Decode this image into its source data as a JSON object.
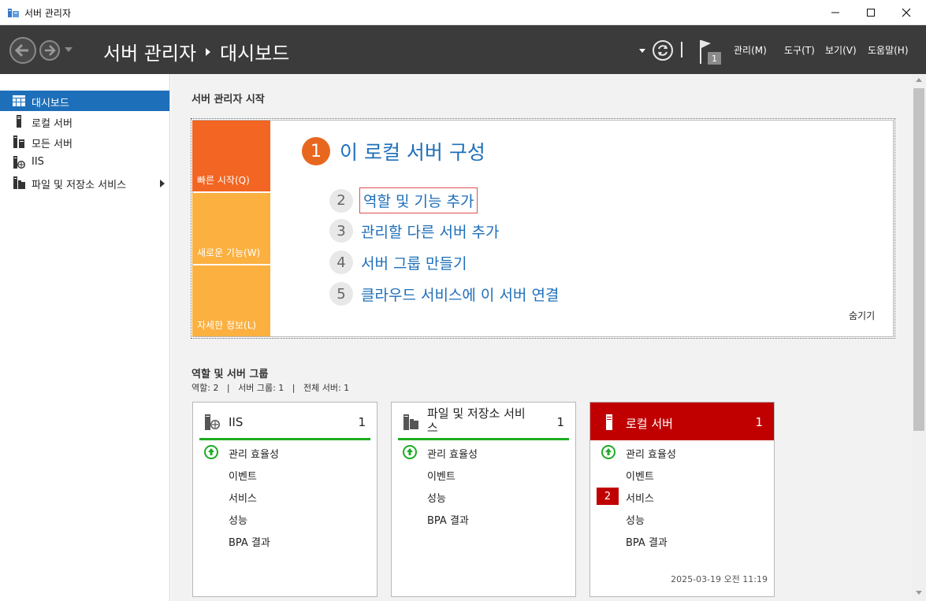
{
  "window": {
    "title": "서버 관리자"
  },
  "header": {
    "breadcrumb_root": "서버 관리자",
    "breadcrumb_page": "대시보드",
    "flag_count": "1",
    "menus": [
      "관리(M)",
      "도구(T)",
      "보기(V)",
      "도움말(H)"
    ]
  },
  "sidebar": {
    "items": [
      {
        "label": "대시보드",
        "icon": "dashboard-icon",
        "selected": true
      },
      {
        "label": "로컬 서버",
        "icon": "server-icon"
      },
      {
        "label": "모든 서버",
        "icon": "servers-icon"
      },
      {
        "label": "IIS",
        "icon": "iis-icon"
      },
      {
        "label": "파일 및 저장소 서비스",
        "icon": "file-storage-icon",
        "has_children": true
      }
    ]
  },
  "welcome": {
    "title": "서버 관리자 시작",
    "tabs": [
      "빠른 시작(Q)",
      "새로운 기능(W)",
      "자세한 정보(L)"
    ],
    "main_step": {
      "number": "1",
      "label": "이 로컬 서버 구성"
    },
    "steps": [
      {
        "number": "2",
        "label": "역할 및 기능 추가"
      },
      {
        "number": "3",
        "label": "관리할 다른 서버 추가"
      },
      {
        "number": "4",
        "label": "서버 그룹 만들기"
      },
      {
        "number": "5",
        "label": "클라우드 서비스에 이 서버 연결"
      }
    ],
    "hide_label": "숨기기"
  },
  "roles": {
    "title": "역할 및 서버 그룹",
    "summary": "역할: 2   |   서버 그룹: 1   |   전체 서버: 1",
    "tiles": [
      {
        "name": "IIS",
        "count": "1",
        "rows": [
          "관리 효율성",
          "이벤트",
          "서비스",
          "성능",
          "BPA 결과"
        ]
      },
      {
        "name_line1": "파일 및 저장소 서비",
        "name_line2": "스",
        "count": "1",
        "rows": [
          "관리 효율성",
          "이벤트",
          "성능",
          "BPA 결과"
        ]
      },
      {
        "name": "로컬 서버",
        "count": "1",
        "rows": [
          "관리 효율성",
          "이벤트",
          "서비스",
          "성능",
          "BPA 결과"
        ],
        "service_badge": "2",
        "timestamp": "2025-03-19 오전 11:19"
      }
    ]
  },
  "colors": {
    "accent_blue": "#1e6fba",
    "quickstart_orange": "#f26522",
    "tab_yellow": "#fbb040",
    "alert_red": "#c00000",
    "status_green": "#1dac23"
  }
}
